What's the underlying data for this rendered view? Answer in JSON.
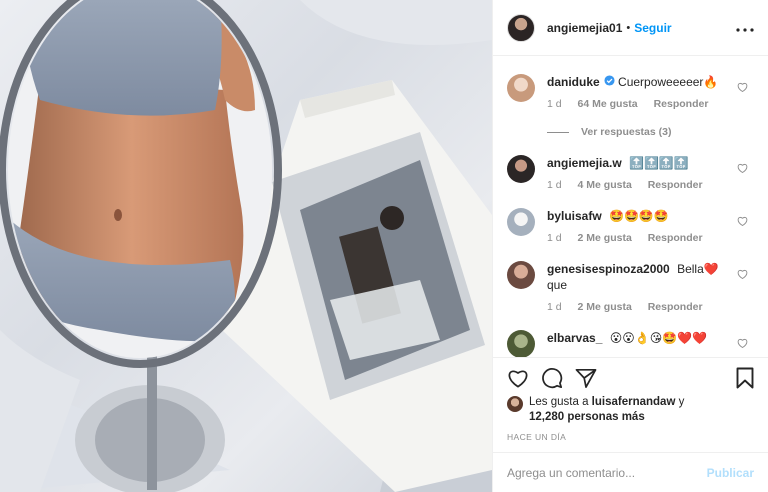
{
  "post": {
    "author": "angiemejia01",
    "follow_label": "Seguir",
    "dot": "•",
    "more_icon": "more-dots-icon"
  },
  "comments": [
    {
      "user": "daniduke",
      "verified": true,
      "text": "Cuerpoweeeeer🔥",
      "time": "1 d",
      "likes": "64 Me gusta",
      "reply": "Responder",
      "avatar_color": "#e6c8b6"
    },
    {
      "user": "angiemejia.w",
      "verified": false,
      "text": "🔝🔝🔝🔝",
      "time": "1 d",
      "likes": "4 Me gusta",
      "reply": "Responder",
      "avatar_color": "#2b2626"
    },
    {
      "user": "byluisafw",
      "verified": false,
      "text": "🤩🤩🤩🤩",
      "time": "1 d",
      "likes": "2 Me gusta",
      "reply": "Responder",
      "avatar_color": "#b9c3cf"
    },
    {
      "user": "genesisespinoza2000",
      "verified": false,
      "text": "Bella❤️ que",
      "time": "1 d",
      "likes": "2 Me gusta",
      "reply": "Responder",
      "avatar_color": "#a78274"
    },
    {
      "user": "elbarvas_",
      "verified": false,
      "text": "😮😮👌😘🤩❤️❤️",
      "time": "",
      "likes": "",
      "reply": "",
      "avatar_color": "#6e7d52"
    }
  ],
  "replies_label": "Ver respuestas (3)",
  "likes_text": {
    "prefix": "Les gusta a",
    "user": "luisafernandaw",
    "suffix": "y",
    "count": "12,280 personas más"
  },
  "posted_ago": "HACE UN DÍA",
  "comment_box": {
    "placeholder": "Agrega un comentario...",
    "publish_label": "Publicar"
  },
  "colors": {
    "accent": "#0095f6",
    "muted": "#8e8e8e",
    "publish_disabled": "#b2dffc"
  }
}
